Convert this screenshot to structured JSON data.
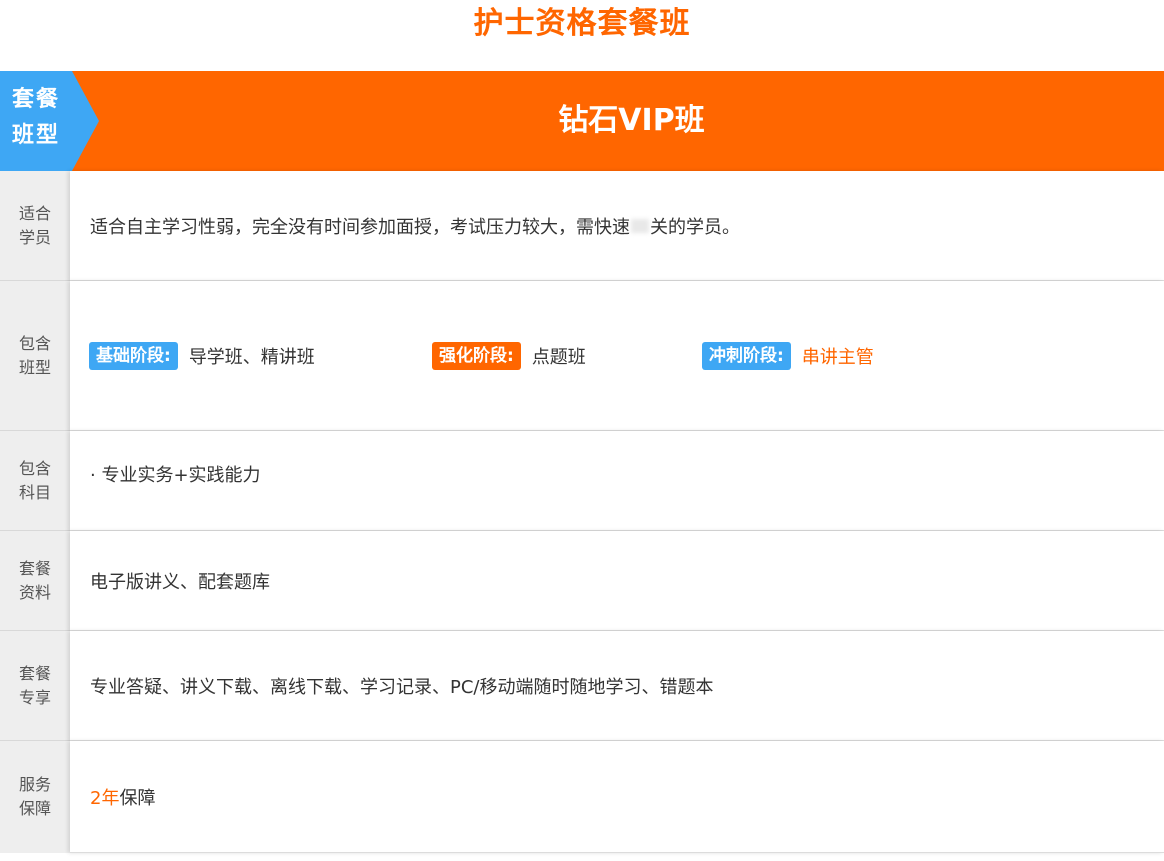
{
  "page_title": "护士资格套餐班",
  "header": {
    "tag_line1": "套餐",
    "tag_line2": "班型",
    "title": "钻石VIP班"
  },
  "rows": {
    "students": {
      "label_line1": "适合",
      "label_line2": "学员",
      "text_before": "适合自主学习性弱，完全没有时间参加面授，考试压力较大，需快速",
      "text_after": "关的学员。"
    },
    "classes": {
      "label_line1": "包含",
      "label_line2": "班型",
      "stages": [
        {
          "badge": "基础阶段:",
          "text": "导学班、精讲班",
          "badge_color": "#3ea7f4"
        },
        {
          "badge": "强化阶段:",
          "text": "点题班",
          "badge_color": "#ff6600"
        },
        {
          "badge": "冲刺阶段:",
          "text": "串讲主管",
          "badge_color": "#3ea7f4"
        }
      ]
    },
    "subjects": {
      "label_line1": "包含",
      "label_line2": "科目",
      "text": "· 专业实务+实践能力"
    },
    "materials": {
      "label_line1": "套餐",
      "label_line2": "资料",
      "text": "电子版讲义、配套题库"
    },
    "exclusive": {
      "label_line1": "套餐",
      "label_line2": "专享",
      "text": "专业答疑、讲义下载、离线下载、学习记录、PC/移动端随时随地学习、错题本"
    },
    "guarantee": {
      "label_line1": "服务",
      "label_line2": "保障",
      "highlight": "2年",
      "text": "保障"
    }
  },
  "colors": {
    "accent_orange": "#ff6600",
    "accent_blue": "#3ea7f4"
  }
}
